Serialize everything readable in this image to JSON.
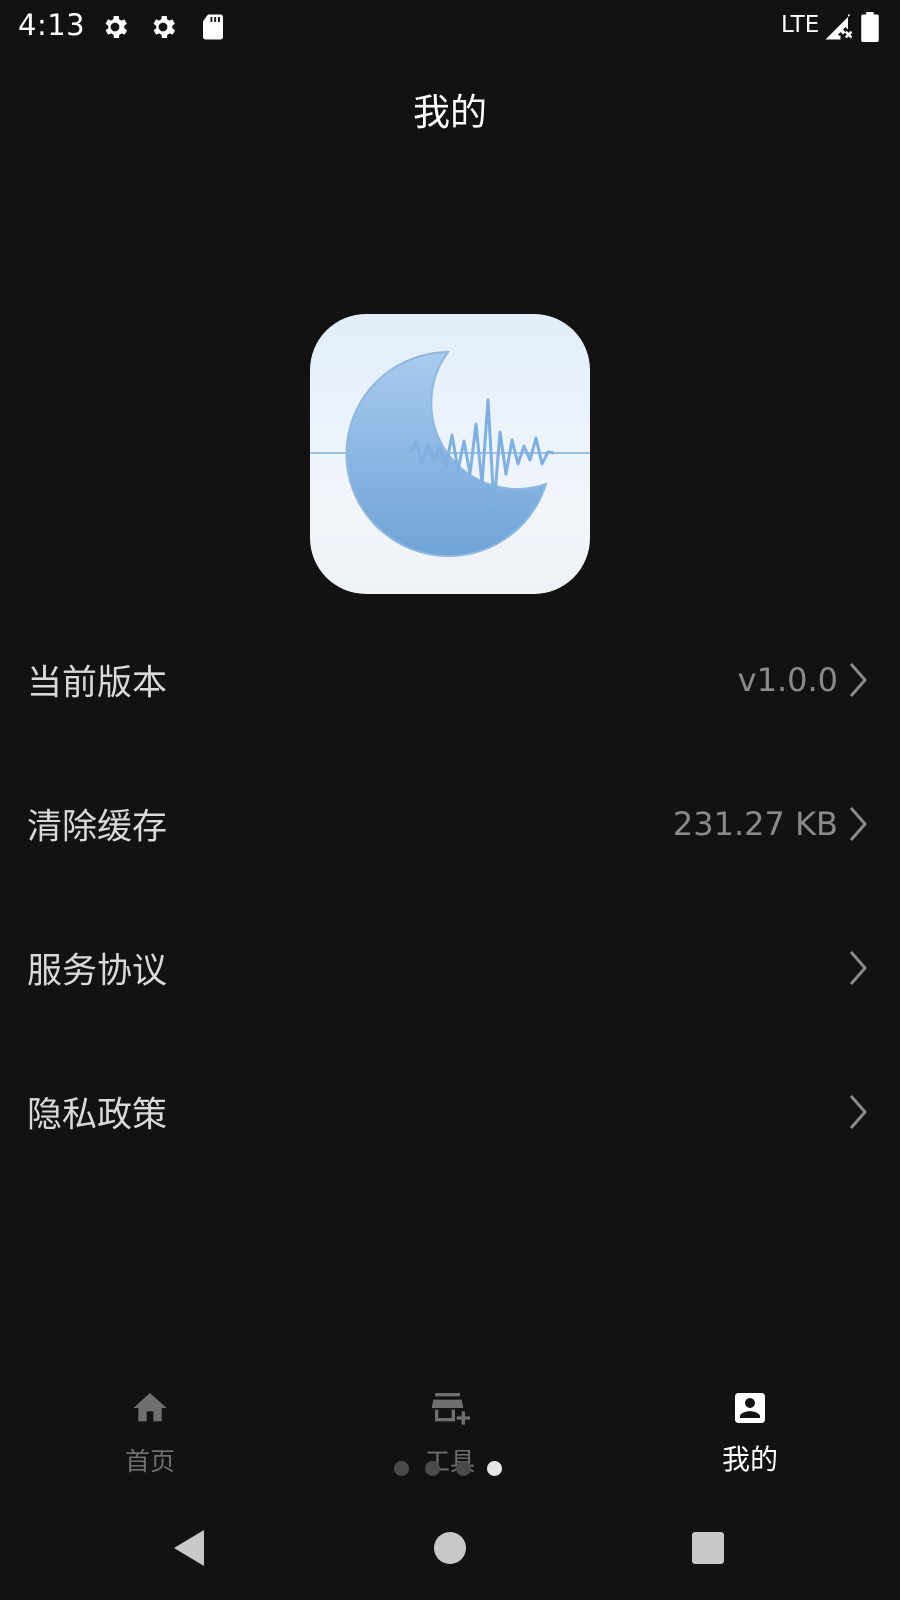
{
  "status_bar": {
    "time": "4:13",
    "network": "LTE",
    "icons": [
      "settings-icon",
      "settings-icon",
      "sd-card-icon",
      "signal-icon",
      "battery-icon"
    ]
  },
  "header": {
    "title": "我的"
  },
  "settings": [
    {
      "label": "当前版本",
      "value": "v1.0.0"
    },
    {
      "label": "清除缓存",
      "value": "231.27 KB"
    },
    {
      "label": "服务协议",
      "value": ""
    },
    {
      "label": "隐私政策",
      "value": ""
    }
  ],
  "bottom_nav": {
    "items": [
      {
        "label": "首页",
        "icon": "home-icon",
        "active": false
      },
      {
        "label": "工具",
        "icon": "store-add-icon",
        "active": false
      },
      {
        "label": "我的",
        "icon": "account-box-icon",
        "active": true
      }
    ]
  },
  "pager": {
    "count": 4,
    "active_index": 3
  },
  "colors": {
    "background": "#121212",
    "text_primary": "#ffffff",
    "text_secondary": "#8a8a8a",
    "nav_inactive": "#6f6f6f",
    "icon_blue": "#6fa3d8"
  }
}
